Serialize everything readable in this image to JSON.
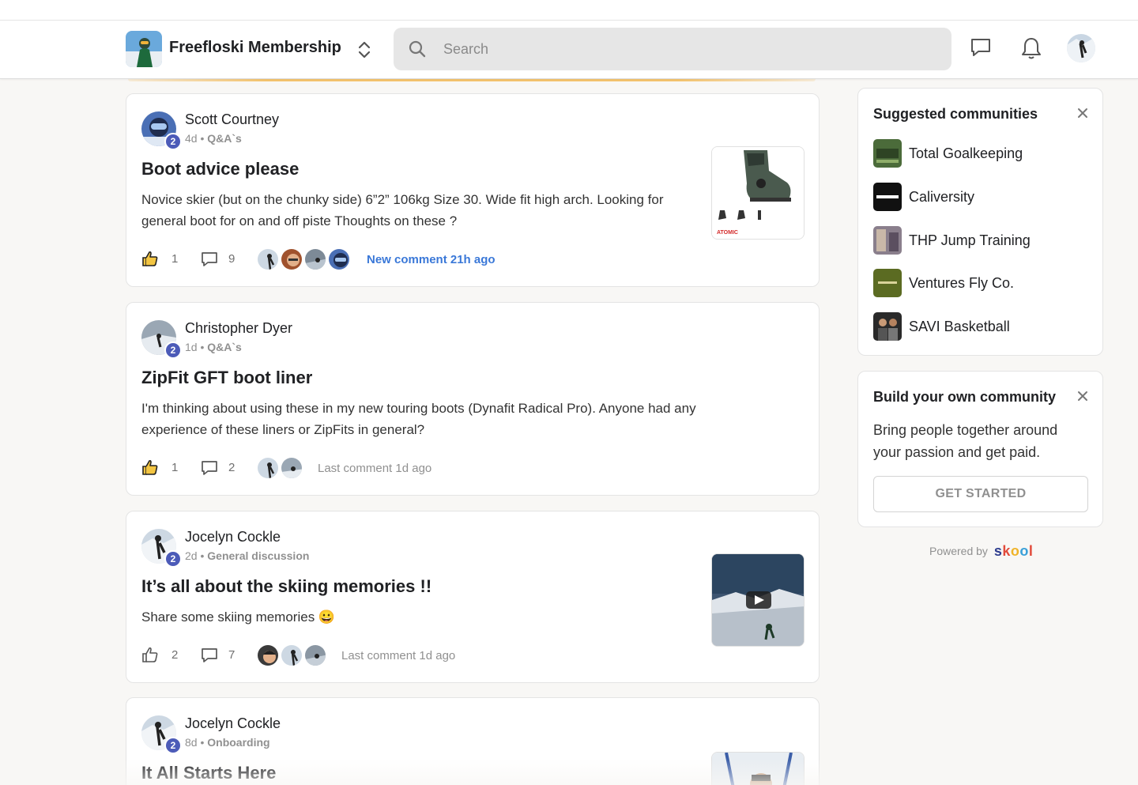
{
  "header": {
    "community_name": "Freefloski Membership",
    "search_placeholder": "Search"
  },
  "posts": [
    {
      "author": "Scott Courtney",
      "level": "2",
      "time": "4d",
      "category": "Q&A`s",
      "title": "Boot advice please",
      "body": "Novice skier (but on the chunky side) 6”2” 106kg Size 30. Wide fit high arch. Looking for general boot for on and off piste Thoughts on these ?",
      "likes": "1",
      "comments": "9",
      "last_comment": "New comment 21h ago",
      "thumbnail": "ski-boot-image"
    },
    {
      "author": "Christopher Dyer",
      "level": "2",
      "time": "1d",
      "category": "Q&A`s",
      "title": "ZipFit GFT boot liner",
      "body": "I'm thinking about using these in my new touring boots (Dynafit Radical Pro). Anyone had any experience of these liners or ZipFits in general?",
      "likes": "1",
      "comments": "2",
      "last_comment": "Last comment 1d ago"
    },
    {
      "author": "Jocelyn Cockle",
      "level": "2",
      "time": "2d",
      "category": "General discussion",
      "title": "It’s all about the skiing memories !!",
      "body": "Share some skiing memories 😀",
      "likes": "2",
      "comments": "7",
      "last_comment": "Last comment 1d ago",
      "thumbnail": "skiing-video"
    },
    {
      "author": "Jocelyn Cockle",
      "level": "2",
      "time": "8d",
      "category": "Onboarding",
      "title": "It All Starts Here"
    }
  ],
  "suggested": {
    "title": "Suggested communities",
    "items": [
      {
        "name": "Total Goalkeeping",
        "color": "#4b6b3a"
      },
      {
        "name": "Caliversity",
        "color": "#111111"
      },
      {
        "name": "THP Jump Training",
        "color": "#8a7f8c"
      },
      {
        "name": "Ventures Fly Co.",
        "color": "#5b6b22"
      },
      {
        "name": "SAVI Basketball",
        "color": "#2a2a2a"
      }
    ]
  },
  "build": {
    "title": "Build your own community",
    "body": "Bring people together around your passion and get paid.",
    "button": "GET STARTED"
  },
  "footer": {
    "powered_by": "Powered by",
    "brand": "skool"
  },
  "colors": {
    "accent_blue": "#3a78d8",
    "level_badge": "#4c5bb8",
    "banner": "#f5c46e"
  }
}
